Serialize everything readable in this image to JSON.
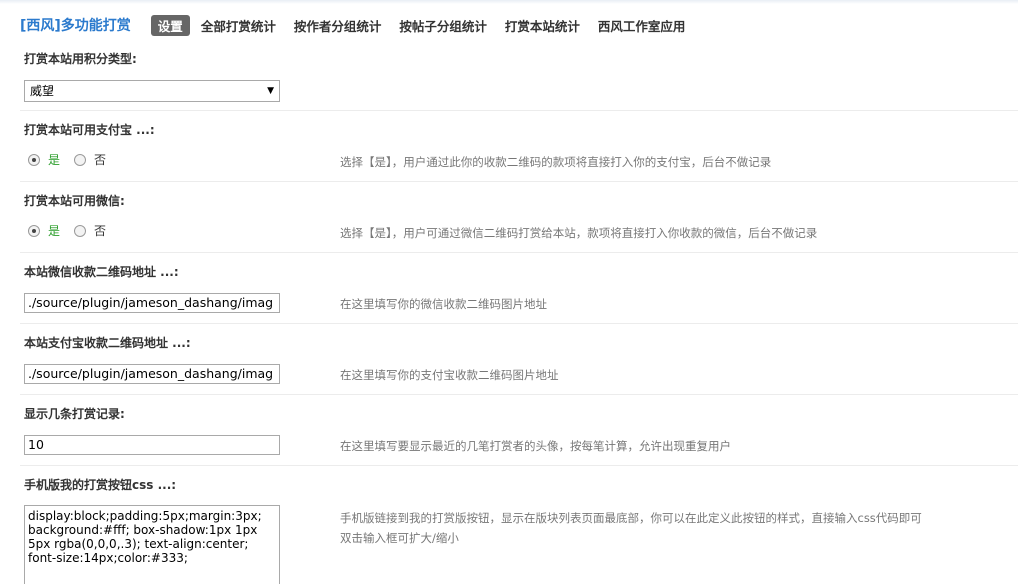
{
  "header": {
    "plugin_title": "[西风]多功能打赏",
    "tabs": [
      {
        "label": "设置",
        "active": true
      },
      {
        "label": "全部打赏统计",
        "active": false
      },
      {
        "label": "按作者分组统计",
        "active": false
      },
      {
        "label": "按帖子分组统计",
        "active": false
      },
      {
        "label": "打赏本站统计",
        "active": false
      },
      {
        "label": "西风工作室应用",
        "active": false
      }
    ]
  },
  "settings": {
    "credit_type": {
      "title": "打赏本站用积分类型:",
      "selected": "威望"
    },
    "alipay_enable": {
      "title": "打赏本站可用支付宝 ...:",
      "yes": "是",
      "no": "否",
      "value": "是",
      "tip": "选择【是】，用户通过此你的收款二维码的款项将直接打入你的支付宝，后台不做记录"
    },
    "wechat_enable": {
      "title": "打赏本站可用微信:",
      "yes": "是",
      "no": "否",
      "value": "是",
      "tip": "选择【是】，用户可通过微信二维码打赏给本站，款项将直接打入你收款的微信，后台不做记录"
    },
    "wechat_qr": {
      "title": "本站微信收款二维码地址 ...:",
      "value": "./source/plugin/jameson_dashang/imag",
      "tip": "在这里填写你的微信收款二维码图片地址"
    },
    "alipay_qr": {
      "title": "本站支付宝收款二维码地址 ...:",
      "value": "./source/plugin/jameson_dashang/imag",
      "tip": "在这里填写你的支付宝收款二维码图片地址"
    },
    "record_count": {
      "title": "显示几条打赏记录:",
      "value": "10",
      "tip": "在这里填写要显示最近的几笔打赏者的头像，按每笔计算，允许出现重复用户"
    },
    "mobile_css": {
      "title": "手机版我的打赏按钮css ...:",
      "value": "display:block;padding:5px;margin:3px;\nbackground:#fff; box-shadow:1px 1px\n5px rgba(0,0,0,.3); text-align:center;\nfont-size:14px;color:#333;",
      "tip": "手机版链接到我的打赏版按钮，显示在版块列表页面最底部，你可以在此定义此按钮的样式，直接输入css代码即可",
      "tip2": "双击输入框可扩大/缩小"
    }
  }
}
